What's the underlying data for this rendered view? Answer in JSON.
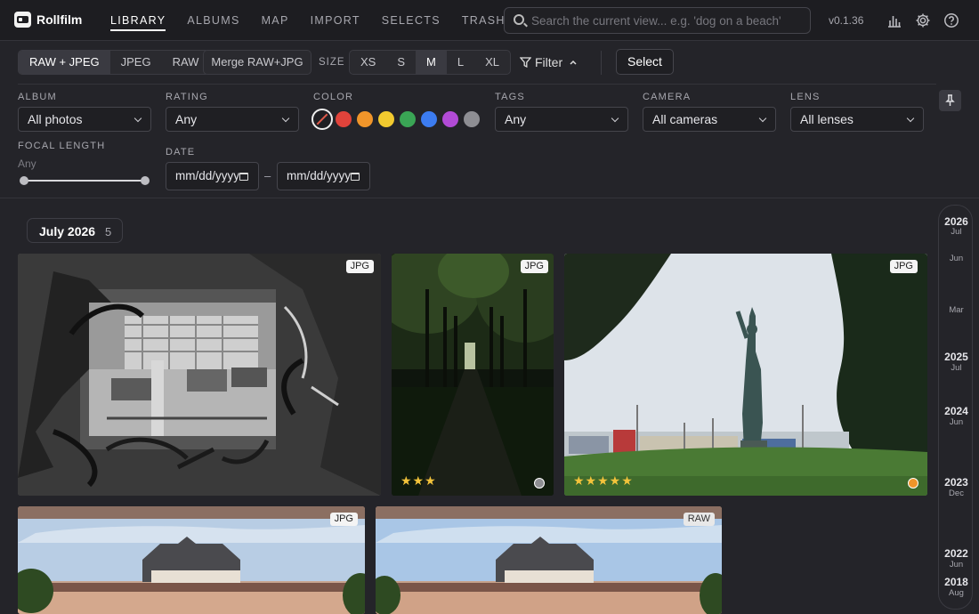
{
  "app": {
    "name": "Rollfilm",
    "version": "v0.1.36"
  },
  "nav": [
    {
      "label": "LIBRARY",
      "active": true
    },
    {
      "label": "ALBUMS"
    },
    {
      "label": "MAP"
    },
    {
      "label": "IMPORT"
    },
    {
      "label": "SELECTS"
    },
    {
      "label": "TRASH"
    }
  ],
  "search": {
    "placeholder": "Search the current view... e.g. 'dog on a beach'"
  },
  "header_icons": [
    "stats-icon",
    "gear-icon",
    "help-icon"
  ],
  "toolbar": {
    "format_options": [
      "RAW + JPEG",
      "JPEG",
      "RAW"
    ],
    "format_selected": "RAW + JPEG",
    "merge_label": "Merge RAW+JPG",
    "size_label": "SIZE",
    "size_options": [
      "XS",
      "S",
      "M",
      "L",
      "XL"
    ],
    "size_selected": "M",
    "filter_label": "Filter",
    "select_label": "Select"
  },
  "filters": {
    "album": {
      "label": "ALBUM",
      "value": "All photos"
    },
    "rating": {
      "label": "RATING",
      "value": "Any"
    },
    "color": {
      "label": "COLOR",
      "swatches": [
        "#e0433b",
        "#f0952a",
        "#f2ca2f",
        "#3aa555",
        "#3c7cf0",
        "#b24bd6",
        "#8e8e93"
      ]
    },
    "tags": {
      "label": "TAGS",
      "value": "Any"
    },
    "camera": {
      "label": "CAMERA",
      "value": "All cameras"
    },
    "lens": {
      "label": "LENS",
      "value": "All lenses"
    },
    "focal_length": {
      "label": "FOCAL LENGTH",
      "value": "Any"
    },
    "date": {
      "label": "DATE",
      "from_placeholder": "mm/dd/yyyy",
      "to_placeholder": "mm/dd/yyyy",
      "separator": "–"
    }
  },
  "gallery": {
    "group": {
      "title": "July 2026",
      "count": "5"
    },
    "photos": [
      {
        "format": "JPG",
        "rating": 0,
        "description": "graffiti"
      },
      {
        "format": "JPG",
        "rating": 3,
        "color": "#8e8e93"
      },
      {
        "format": "JPG",
        "rating": 5,
        "color": "#f0952a"
      },
      {
        "format": "JPG",
        "rating": 0
      },
      {
        "format": "RAW",
        "rating": 0
      }
    ]
  },
  "timeline": [
    {
      "year": "2026",
      "month": "Jul"
    },
    {
      "month": "Jun"
    },
    {
      "month": "Mar"
    },
    {
      "year": "2025",
      "month": "Jul"
    },
    {
      "year": "2024",
      "month": "Jun"
    },
    {
      "year": "2023",
      "month": "Dec"
    },
    {
      "year": "2022",
      "month": "Jun"
    },
    {
      "year": "2018",
      "month": "Aug"
    }
  ]
}
